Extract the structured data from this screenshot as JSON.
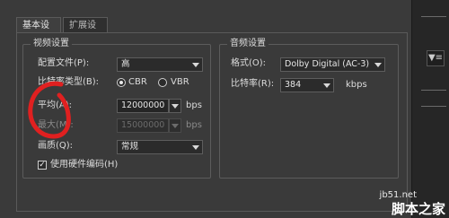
{
  "tabs": [
    {
      "label": "基本设置",
      "active": true
    },
    {
      "label": "扩展设置",
      "active": false
    }
  ],
  "video": {
    "title": "视频设置",
    "profile_label": "配置文件(P):",
    "profile_value": "高",
    "bitrate_type_label": "比特率类型(B):",
    "cbr_label": "CBR",
    "vbr_label": "VBR",
    "selected_mode": "CBR",
    "average_label": "平均(A):",
    "average_value": "12000000",
    "average_unit": "bps",
    "max_label": "最大(M):",
    "max_value": "15000000",
    "max_unit": "bps",
    "quality_label": "画质(Q):",
    "quality_value": "常规",
    "hw_encode_label": "使用硬件编码(H)",
    "hw_encode_checked": true
  },
  "audio": {
    "title": "音频设置",
    "format_label": "格式(O):",
    "format_value": "Dolby Digital (AC-3)",
    "bitrate_label": "比特率(R):",
    "bitrate_value": "384",
    "bitrate_unit": "kbps"
  },
  "watermark": {
    "url": "jb51.net",
    "name": "脚本之家"
  },
  "side_toolbar": {
    "button_glyph": "▼≡"
  },
  "colors": {
    "annotation": "#e02020",
    "background": "#3a3a3a"
  }
}
